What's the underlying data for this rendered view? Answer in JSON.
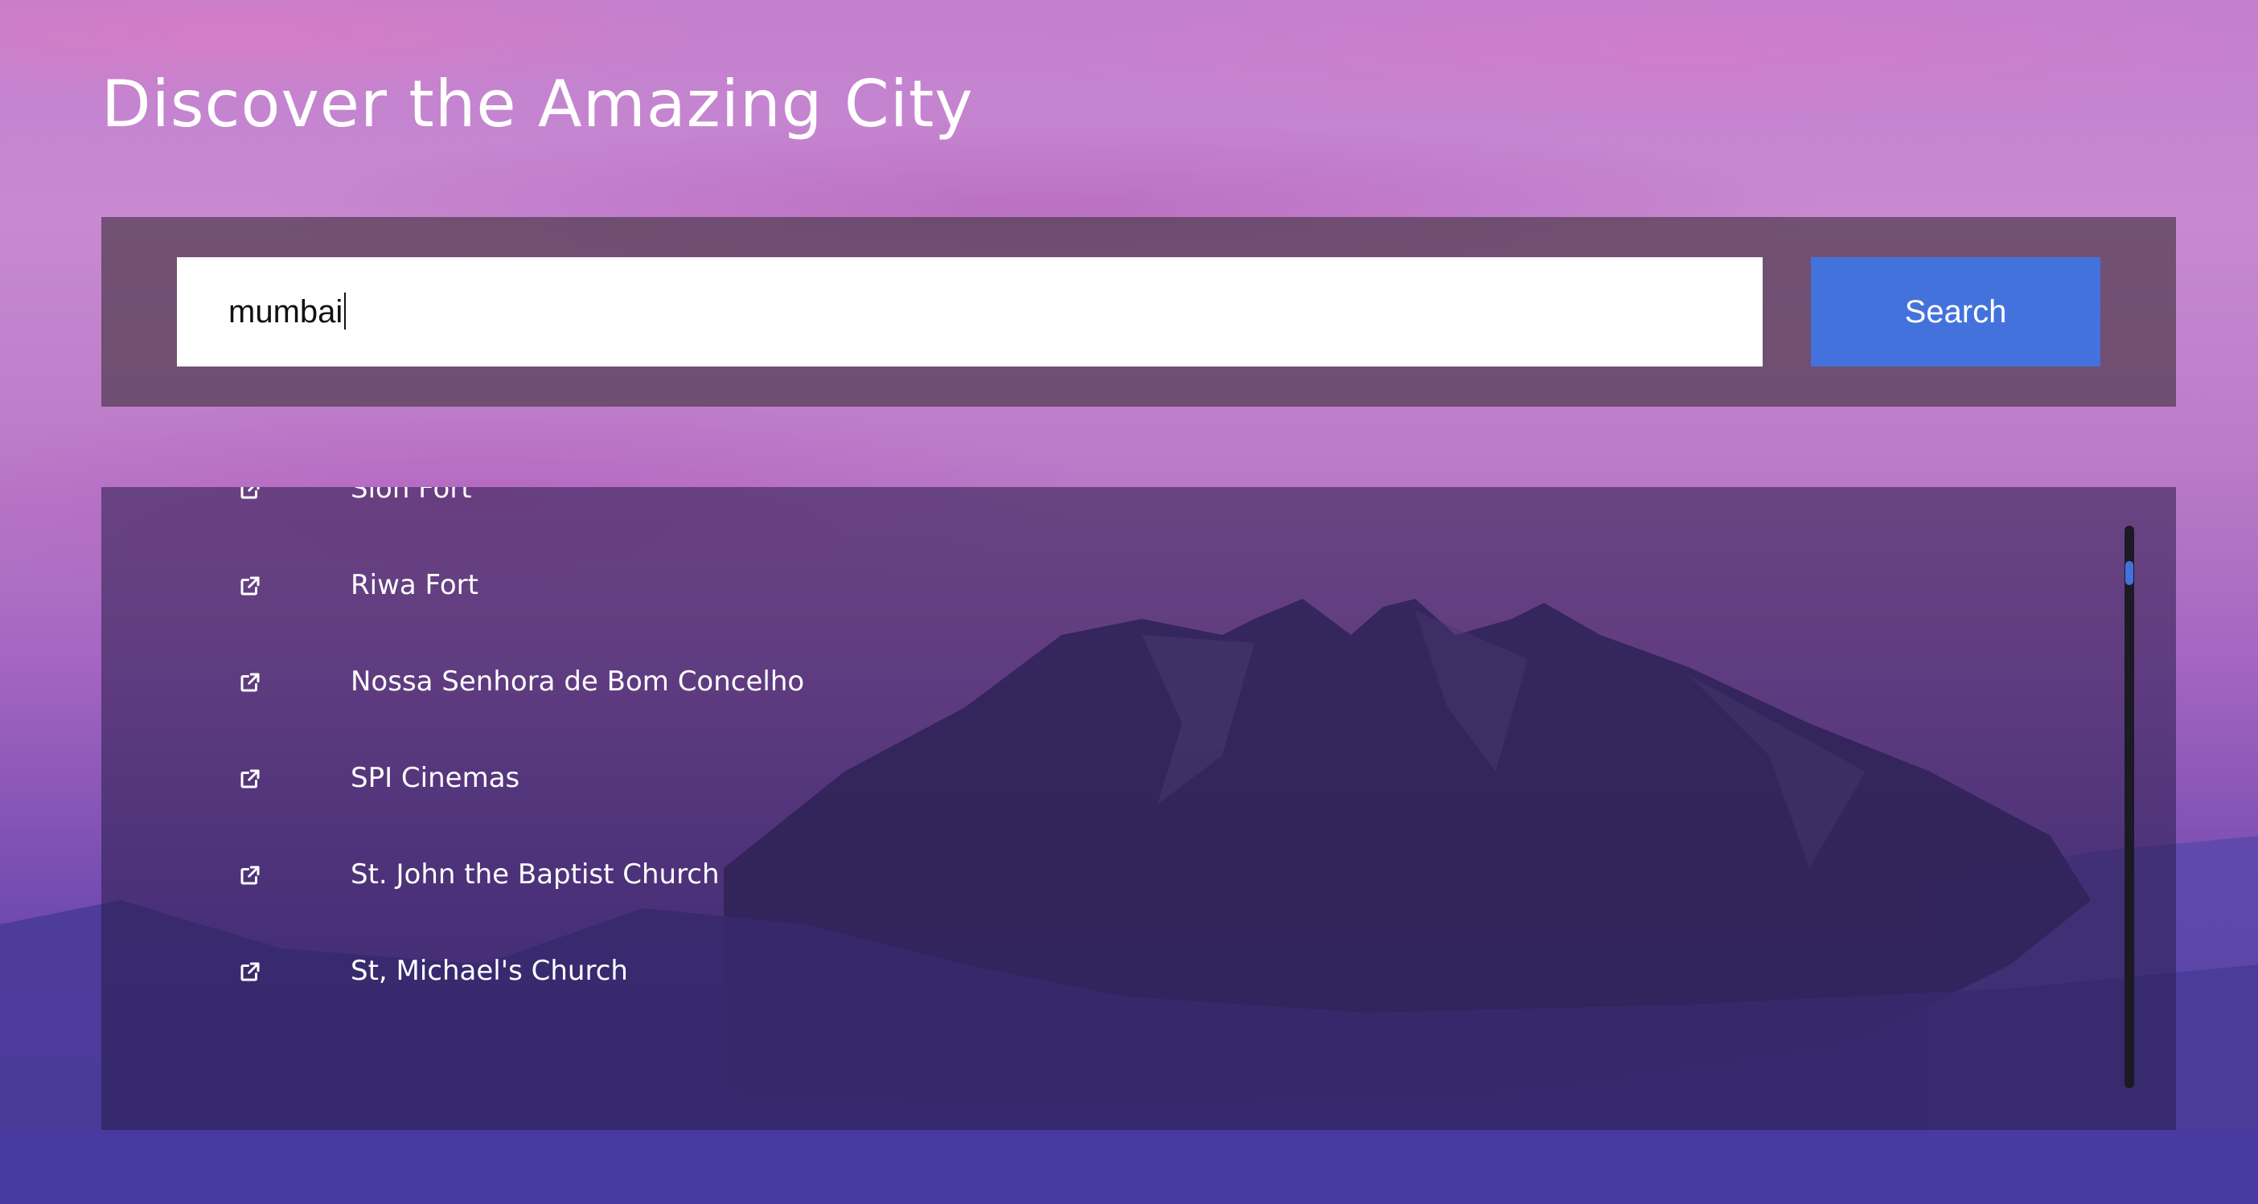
{
  "page": {
    "title": "Discover the Amazing City"
  },
  "search": {
    "value": "mumbai",
    "button_label": "Search"
  },
  "results": [
    {
      "name": "Sion Fort",
      "icon": "external-link-icon"
    },
    {
      "name": "Riwa Fort",
      "icon": "external-link-icon"
    },
    {
      "name": "Nossa Senhora de Bom Concelho",
      "icon": "external-link-icon"
    },
    {
      "name": "SPI Cinemas",
      "icon": "external-link-icon"
    },
    {
      "name": "St. John the Baptist Church",
      "icon": "external-link-icon"
    },
    {
      "name": "St, Michael's Church",
      "icon": "external-link-icon"
    }
  ],
  "colors": {
    "accent": "#4472dc",
    "panel": "#50384f",
    "text": "#ffffff"
  }
}
